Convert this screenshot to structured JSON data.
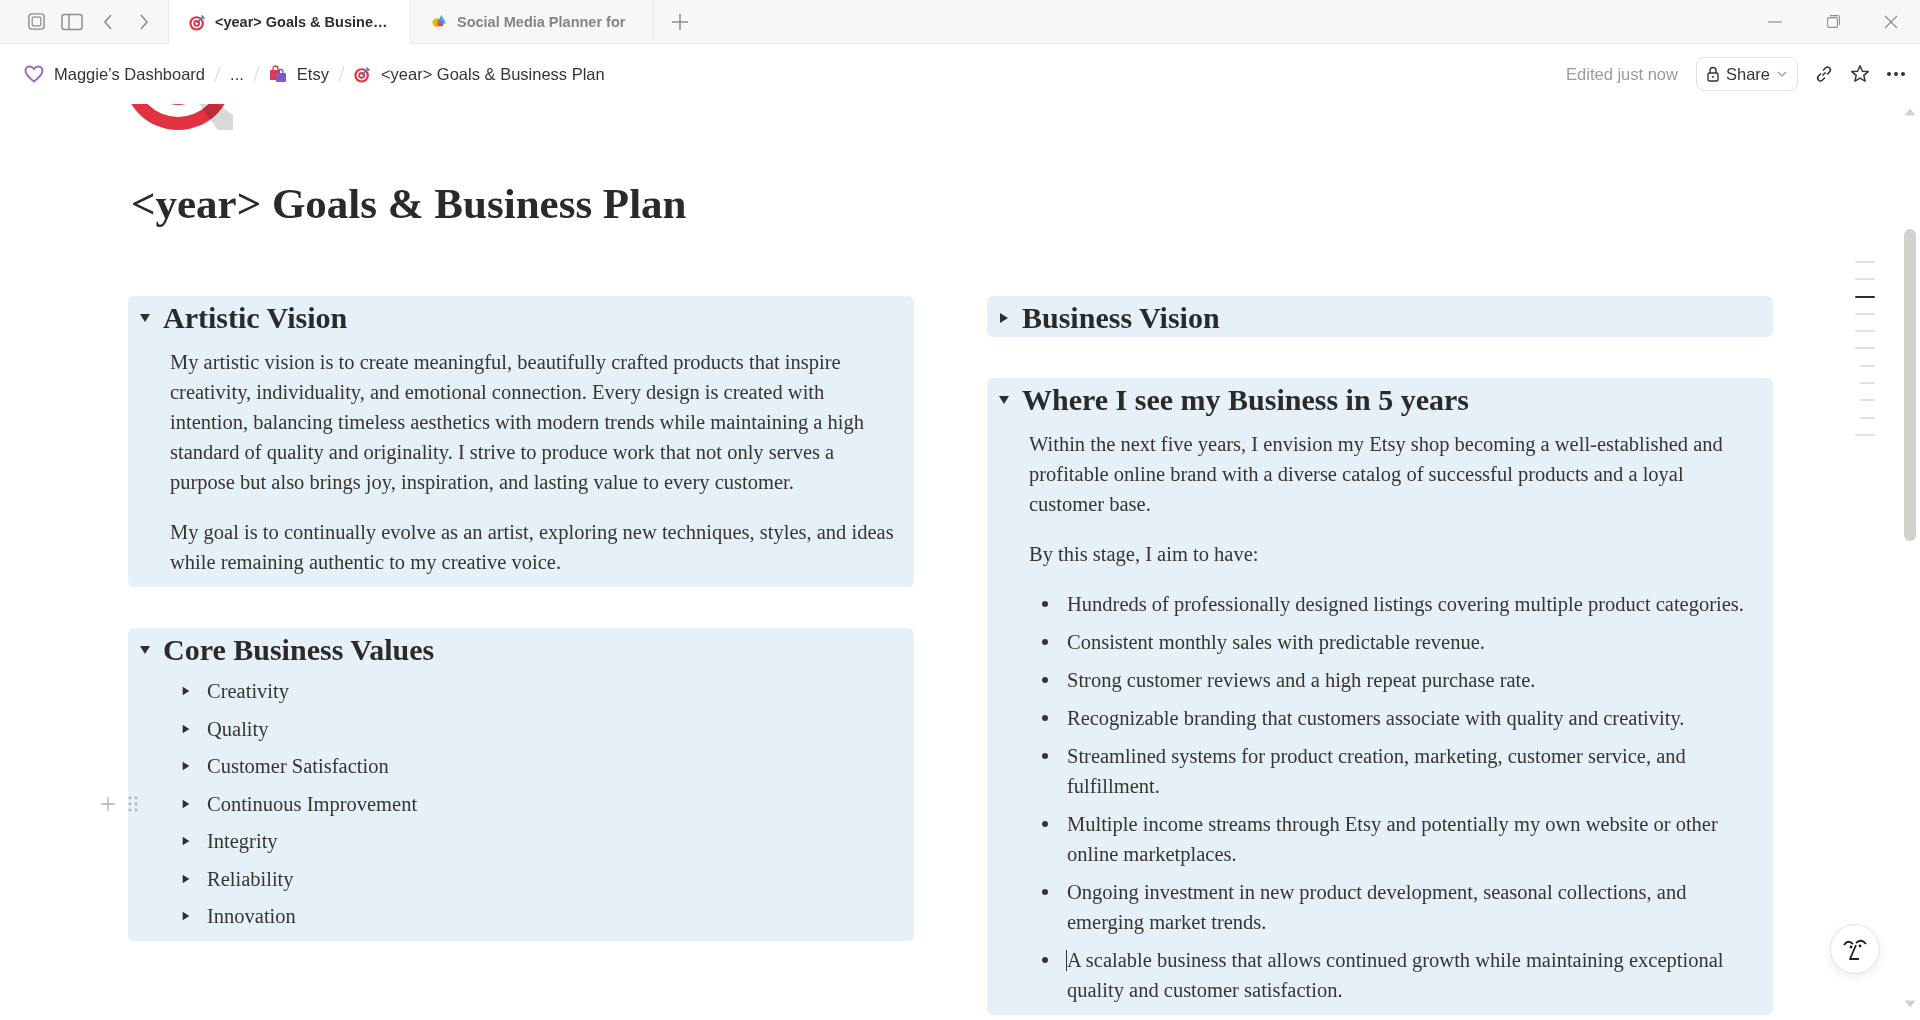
{
  "tabs": [
    {
      "title": "<year> Goals & Busine…",
      "selected": true
    },
    {
      "title": "Social Media Planner for",
      "selected": false
    }
  ],
  "breadcrumbs": {
    "workspace": "Maggie’s Dashboard",
    "collapsed": "...",
    "parent": "Etsy",
    "current": "<year> Goals & Business Plan"
  },
  "header": {
    "status": "Edited just now",
    "share": "Share"
  },
  "page": {
    "title": "<year> Goals & Business Plan"
  },
  "outline": [
    {
      "selected": false
    },
    {
      "selected": false
    },
    {
      "selected": true
    },
    {
      "selected": false
    },
    {
      "selected": false
    },
    {
      "selected": false,
      "children": [
        {
          "selected": false
        },
        {
          "selected": false
        },
        {
          "selected": false
        },
        {
          "selected": false
        }
      ]
    },
    {
      "selected": false
    }
  ],
  "columns": [
    [
      {
        "heading": "Artistic Vision",
        "expanded": true,
        "blocks": [
          {
            "kind": "paragraph",
            "text": "My artistic vision is to create meaningful, beautifully crafted products that inspire creativity, individuality, and emotional connection. Every design is created with intention, balancing timeless aesthetics with modern trends while maintaining a high standard of quality and originality. I strive to produce work that not only serves a purpose but also brings joy, inspiration, and lasting value to every customer."
          },
          {
            "kind": "paragraph",
            "text": "My goal is to continually evolve as an artist, exploring new techniques, styles, and ideas while remaining authentic to my creative voice."
          }
        ]
      },
      {
        "heading": "Core Business Values",
        "expanded": true,
        "blocks": [
          {
            "kind": "toggle",
            "text": "Creativity",
            "expanded": false,
            "hovered": false
          },
          {
            "kind": "toggle",
            "text": "Quality",
            "expanded": false,
            "hovered": false
          },
          {
            "kind": "toggle",
            "text": "Customer Satisfaction",
            "expanded": false,
            "hovered": false
          },
          {
            "kind": "toggle",
            "text": "Continuous Improvement",
            "expanded": false,
            "hovered": true
          },
          {
            "kind": "toggle",
            "text": "Integrity",
            "expanded": false,
            "hovered": false
          },
          {
            "kind": "toggle",
            "text": "Reliability",
            "expanded": false,
            "hovered": false
          },
          {
            "kind": "toggle",
            "text": "Innovation",
            "expanded": false,
            "hovered": false
          }
        ]
      }
    ],
    [
      {
        "heading": "Business Vision",
        "expanded": false
      },
      {
        "heading": "Where I see my Business in 5 years",
        "expanded": true,
        "blocks": [
          {
            "kind": "paragraph",
            "text": "Within the next five years, I envision my Etsy shop becoming a well-established and profitable online brand with a diverse catalog of successful products and a loyal customer base.",
            "focused": false
          },
          {
            "kind": "paragraph",
            "text": "By this stage, I aim to have:",
            "focused": false
          },
          {
            "kind": "bullet",
            "text": "Hundreds of professionally designed listings covering multiple product categories.",
            "focused": false
          },
          {
            "kind": "bullet",
            "text": "Consistent monthly sales with predictable revenue.",
            "focused": false
          },
          {
            "kind": "bullet",
            "text": "Strong customer reviews and a high repeat purchase rate.",
            "focused": false
          },
          {
            "kind": "bullet",
            "text": "Recognizable branding that customers associate with quality and creativity.",
            "focused": false
          },
          {
            "kind": "bullet",
            "text": "Streamlined systems for product creation, marketing, customer service, and fulfillment.",
            "focused": false
          },
          {
            "kind": "bullet",
            "text": "Multiple income streams through Etsy and potentially my own website or other online marketplaces.",
            "focused": false
          },
          {
            "kind": "bullet",
            "text": "Ongoing investment in new product development, seasonal collections, and emerging market trends.",
            "focused": false
          },
          {
            "kind": "bullet",
            "text": "A scalable business that allows continued growth while maintaining exceptional quality and customer satisfaction.",
            "focused": true
          }
        ]
      }
    ]
  ]
}
